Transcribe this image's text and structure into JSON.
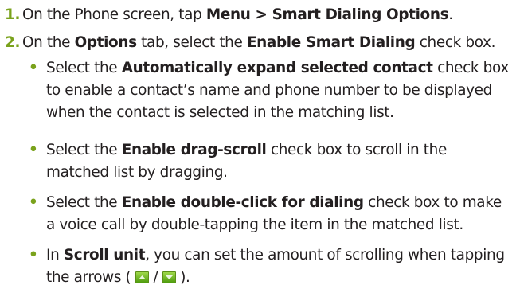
{
  "steps": [
    {
      "number": "1.",
      "parts": [
        "On the Phone screen, tap ",
        "Menu > Smart Dialing Options",
        "."
      ]
    },
    {
      "number": "2.",
      "parts": [
        "On the ",
        "Options",
        " tab, select the ",
        "Enable Smart Dialing",
        " check box."
      ]
    }
  ],
  "bullets": [
    {
      "parts": [
        "Select the ",
        "Automatically expand selected contact",
        " check box to enable a contact’s name and phone number to be displayed when the contact is selected in the matching list."
      ]
    },
    {
      "parts": [
        "Select the ",
        "Enable drag-scroll",
        " check box to scroll in the matched list by dragging."
      ]
    },
    {
      "parts": [
        "Select the ",
        "Enable double-click for dialing",
        " check box to make a voice call by double-tapping the item in the matched list."
      ]
    },
    {
      "parts": [
        "In ",
        "Scroll unit",
        ", you can set the amount of scrolling when tapping the arrows ( ",
        " / ",
        " )."
      ]
    }
  ],
  "bullet_symbol": "•",
  "icons": {
    "up_arrow": "scroll-up-arrow-icon",
    "down_arrow": "scroll-down-arrow-icon"
  },
  "colors": {
    "accent_green": "#7aa21c",
    "text": "#231f20"
  }
}
